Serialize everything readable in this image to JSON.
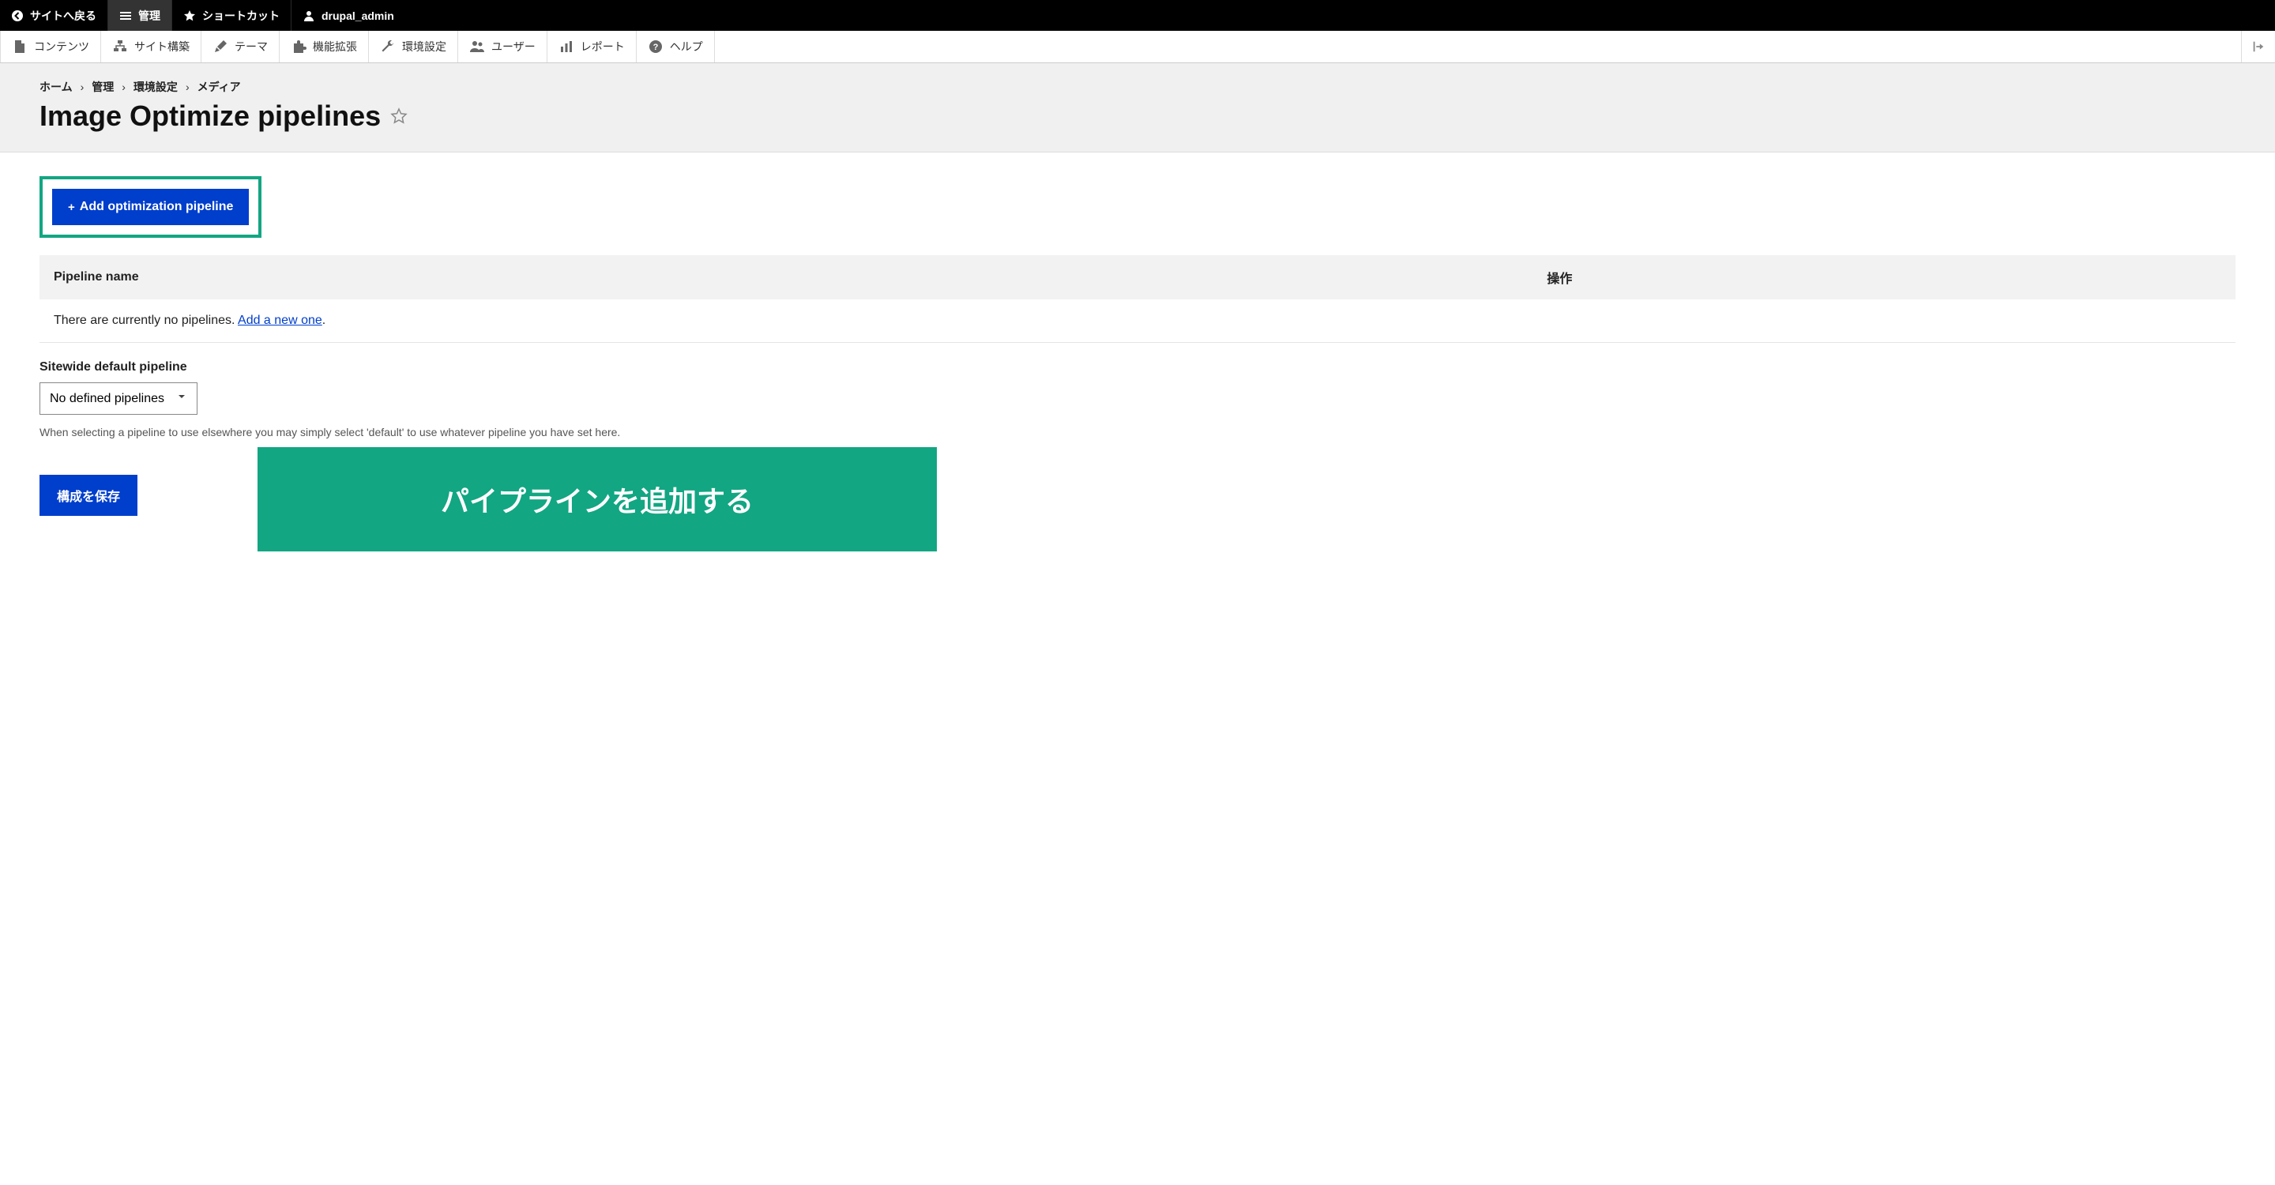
{
  "topbar": {
    "back": "サイトへ戻る",
    "manage": "管理",
    "shortcuts": "ショートカット",
    "user": "drupal_admin"
  },
  "adminbar": {
    "content": "コンテンツ",
    "structure": "サイト構築",
    "appearance": "テーマ",
    "extend": "機能拡張",
    "config": "環境設定",
    "people": "ユーザー",
    "reports": "レポート",
    "help": "ヘルプ"
  },
  "breadcrumb": {
    "home": "ホーム",
    "manage": "管理",
    "config": "環境設定",
    "media": "メディア"
  },
  "page_title": "Image Optimize pipelines",
  "add_button": "Add optimization pipeline",
  "table": {
    "col_name": "Pipeline name",
    "col_ops": "操作",
    "empty_prefix": "There are currently no pipelines. ",
    "empty_link": "Add a new one",
    "empty_suffix": "."
  },
  "field": {
    "label": "Sitewide default pipeline",
    "selected": "No defined pipelines",
    "help": "When selecting a pipeline to use elsewhere you may simply select 'default' to use whatever pipeline you have set here."
  },
  "save_button": "構成を保存",
  "overlay_text": "パイプラインを追加する"
}
